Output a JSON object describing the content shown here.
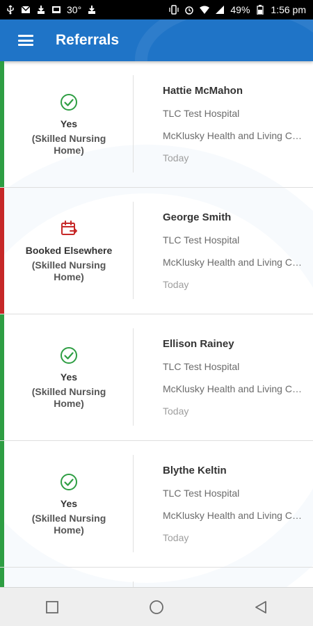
{
  "status_bar": {
    "temperature": "30°",
    "battery": "49%",
    "time": "1:56 pm"
  },
  "app_bar": {
    "title": "Referrals"
  },
  "colors": {
    "app_bar": "#1f74c7",
    "yes": "#2e9e43",
    "booked_elsewhere": "#c62828"
  },
  "referrals": [
    {
      "status": "yes",
      "status_icon": "check-circle-icon",
      "status_label": "Yes",
      "status_sub": "(Skilled Nursing Home)",
      "name": "Hattie McMahon",
      "hospital": "TLC Test Hospital",
      "facility": "McKlusky Health and Living Center",
      "date": "Today"
    },
    {
      "status": "booked_elsewhere",
      "status_icon": "calendar-arrow-icon",
      "status_label": "Booked Elsewhere",
      "status_sub": "(Skilled Nursing Home)",
      "name": "George Smith",
      "hospital": "TLC Test Hospital",
      "facility": "McKlusky Health and Living Center",
      "date": "Today"
    },
    {
      "status": "yes",
      "status_icon": "check-circle-icon",
      "status_label": "Yes",
      "status_sub": "(Skilled Nursing Home)",
      "name": "Ellison Rainey",
      "hospital": "TLC Test Hospital",
      "facility": "McKlusky Health and Living Center",
      "date": "Today"
    },
    {
      "status": "yes",
      "status_icon": "check-circle-icon",
      "status_label": "Yes",
      "status_sub": "(Skilled Nursing Home)",
      "name": "Blythe Keltin",
      "hospital": "TLC Test Hospital",
      "facility": "McKlusky Health and Living Center",
      "date": "Today"
    }
  ],
  "nav_bar": {
    "recents_icon": "square-icon",
    "home_icon": "circle-icon",
    "back_icon": "triangle-back-icon"
  }
}
